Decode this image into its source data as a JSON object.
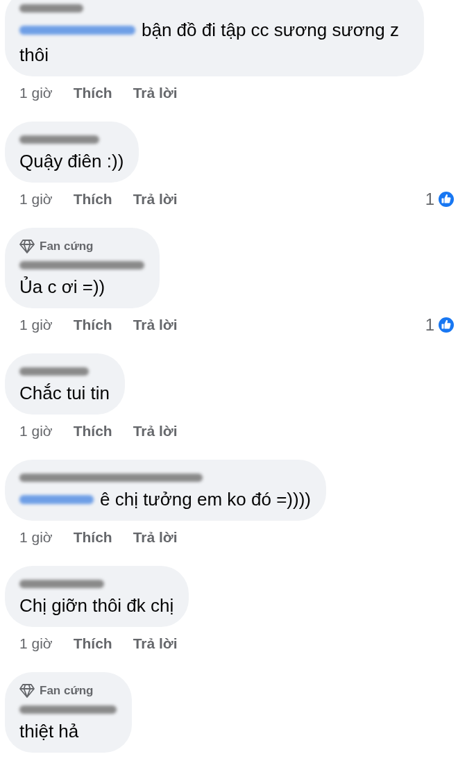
{
  "comments": [
    {
      "mention": true,
      "text": "bận đồ đi tập cc sương sương z thôi",
      "actions": {
        "time": "1 giờ",
        "like": "Thích",
        "reply": "Trả lời"
      }
    },
    {
      "mention": false,
      "text": "Quậy điên :))",
      "actions": {
        "time": "1 giờ",
        "like": "Thích",
        "reply": "Trả lời"
      },
      "reactions": {
        "count": "1"
      }
    },
    {
      "badge": "Fan cứng",
      "mention": false,
      "text": "Ủa c ơi =))",
      "actions": {
        "time": "1 giờ",
        "like": "Thích",
        "reply": "Trả lời"
      },
      "reactions": {
        "count": "1"
      }
    },
    {
      "mention": false,
      "text": "Chắc tui tin",
      "actions": {
        "time": "1 giờ",
        "like": "Thích",
        "reply": "Trả lời"
      }
    },
    {
      "mention": true,
      "text": "ê chị tưởng em ko đó =))))",
      "actions": {
        "time": "1 giờ",
        "like": "Thích",
        "reply": "Trả lời"
      }
    },
    {
      "mention": false,
      "text": "Chị giỡn thôi đk chị",
      "actions": {
        "time": "1 giờ",
        "like": "Thích",
        "reply": "Trả lời"
      }
    },
    {
      "badge": "Fan cứng",
      "mention": false,
      "text": "thiệt hả"
    }
  ]
}
